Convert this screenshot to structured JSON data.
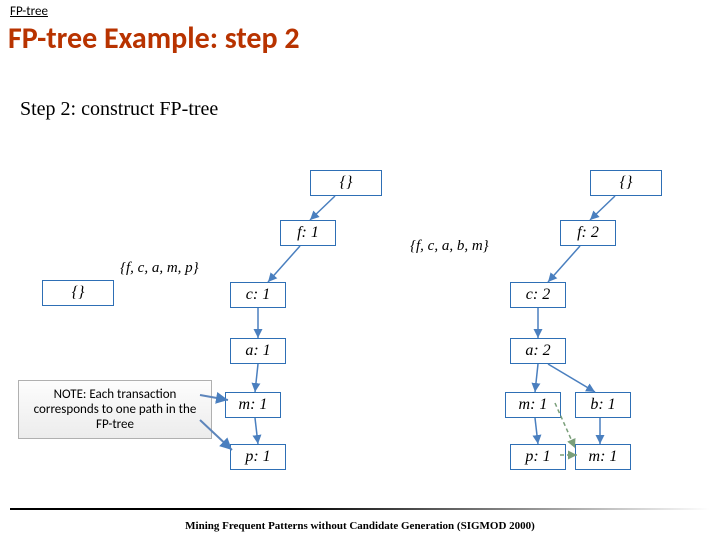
{
  "breadcrumb": "FP-tree",
  "title": "FP-tree Example: step 2",
  "subtitle": "Step 2: construct  FP-tree",
  "roots": {
    "left": "{}",
    "right": "{}",
    "empty": "{}"
  },
  "transactions": {
    "t1": "{f, c, a, m, p}",
    "t2": "{f, c, a, b, m}"
  },
  "tree1": {
    "f": "f: 1",
    "c": "c: 1",
    "a": "a: 1",
    "m": "m: 1",
    "p": "p: 1"
  },
  "tree2": {
    "f": "f: 2",
    "c": "c: 2",
    "a": "a: 2",
    "m": "m: 1",
    "p": "p: 1",
    "b": "b: 1",
    "m2": "m: 1"
  },
  "note": "NOTE: Each transaction corresponds to one path in the FP-tree",
  "footer": "Mining Frequent Patterns without Candidate Generation (SIGMOD 2000)"
}
